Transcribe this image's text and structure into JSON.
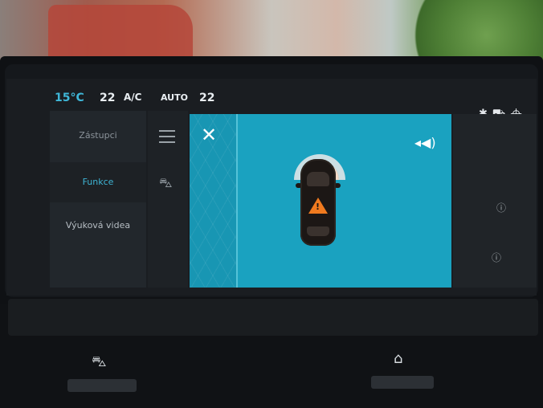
{
  "climate": {
    "driver_temp": "15°C",
    "fan": "22",
    "ac_label": "A/C",
    "auto_label": "AUTO",
    "passenger_temp": "22"
  },
  "sidebar": {
    "items": [
      {
        "label": "Zástupci"
      },
      {
        "label": "Funkce"
      },
      {
        "label": "Výuková videa"
      }
    ]
  },
  "parking": {
    "close_glyph": "✕",
    "speaker_glyph": "◂◀)",
    "warning_glyph": "!"
  },
  "status_icons": [
    "bluetooth-icon",
    "car-icon",
    "location-icon"
  ],
  "colors": {
    "accent": "#3eb4d4",
    "park_bg": "#1aa2c0",
    "warning": "#f07a1f"
  }
}
